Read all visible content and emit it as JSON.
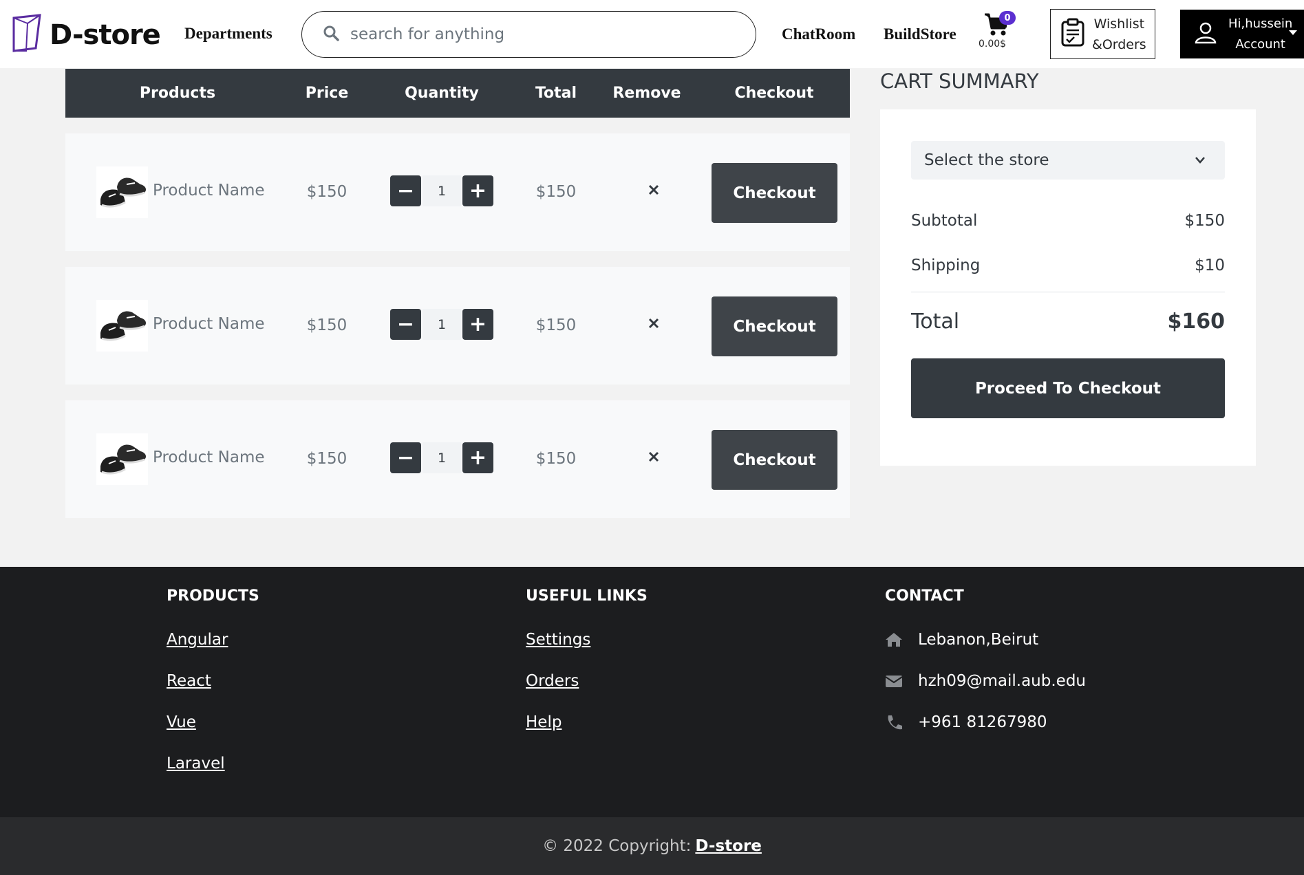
{
  "header": {
    "brand": "D-store",
    "departments": "Departments",
    "search_placeholder": "search for anything",
    "chatroom": "ChatRoom",
    "buildstore": "BuildStore",
    "cart_count": "0",
    "cart_amount": "0.00$",
    "wishlist_line1": "Wishlist",
    "wishlist_line2": "&Orders",
    "account_line1": "Hi,hussein",
    "account_line2": "Account"
  },
  "table": {
    "headers": [
      "Products",
      "Price",
      "Quantity",
      "Total",
      "Remove",
      "Checkout"
    ],
    "rows": [
      {
        "name": "Product Name",
        "price": "$150",
        "qty": "1",
        "total": "$150",
        "checkout": "Checkout"
      },
      {
        "name": "Product Name",
        "price": "$150",
        "qty": "1",
        "total": "$150",
        "checkout": "Checkout"
      },
      {
        "name": "Product Name",
        "price": "$150",
        "qty": "1",
        "total": "$150",
        "checkout": "Checkout"
      }
    ]
  },
  "summary": {
    "title": "CART SUMMARY",
    "store_select": "Select the store",
    "subtotal_label": "Subtotal",
    "subtotal_value": "$150",
    "shipping_label": "Shipping",
    "shipping_value": "$10",
    "total_label": "Total",
    "total_value": "$160",
    "proceed": "Proceed To Checkout"
  },
  "footer": {
    "products_title": "PRODUCTS",
    "products": [
      "Angular",
      "React",
      "Vue",
      "Laravel"
    ],
    "links_title": "USEFUL LINKS",
    "links": [
      "Settings",
      "Orders",
      "Help"
    ],
    "contact_title": "CONTACT",
    "address": "Lebanon,Beirut",
    "email": "hzh09@mail.aub.edu",
    "phone": "+961 81267980",
    "copyright_prefix": "© 2022 Copyright:",
    "copyright_brand": "D-store"
  },
  "colors": {
    "dark": "#343a40",
    "badge": "#5b2fd0",
    "footer_bg": "#1c1d1f"
  },
  "icons": {
    "logo": "cube-logo-icon",
    "search": "search-icon",
    "cart": "cart-icon",
    "wishlist": "clipboard-list-icon",
    "account": "user-icon",
    "remove": "close-icon",
    "select": "chevron-down-icon",
    "address": "home-icon",
    "email": "envelope-icon",
    "phone": "phone-icon"
  }
}
